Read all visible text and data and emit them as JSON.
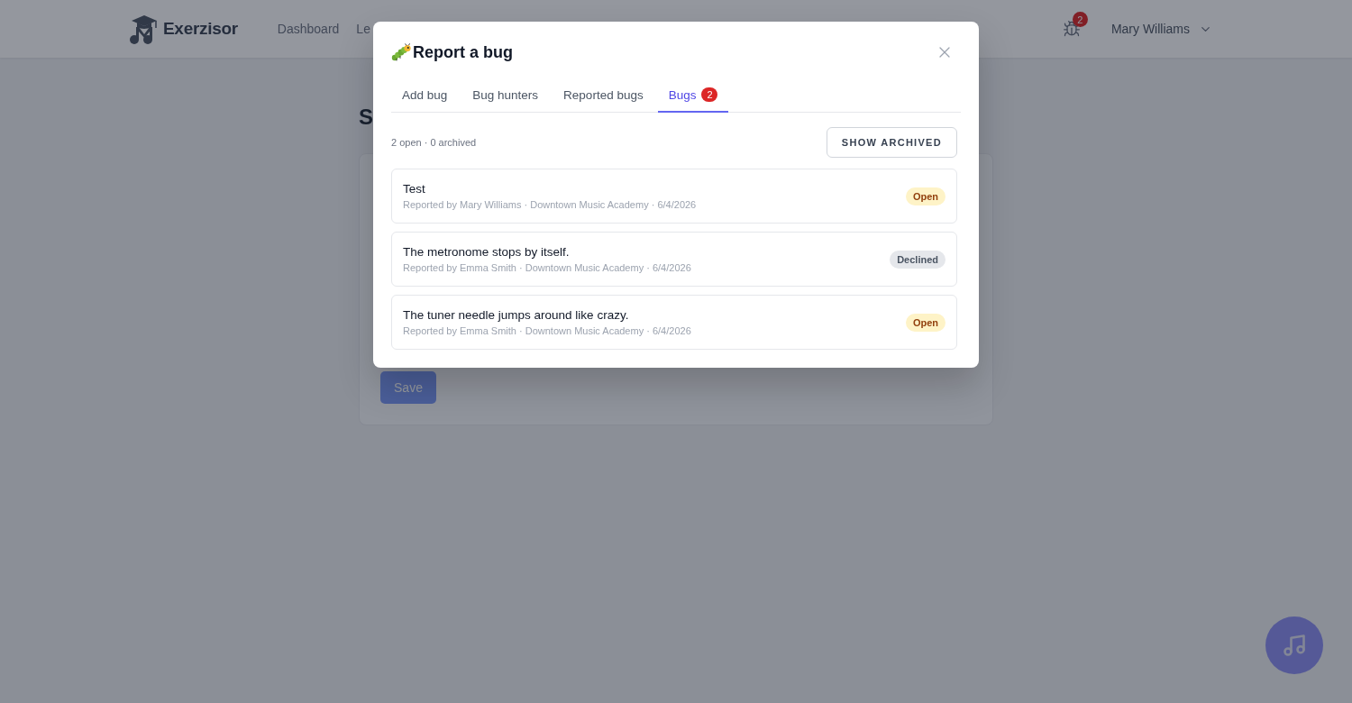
{
  "navbar": {
    "brand": "Exerzisor",
    "links": [
      "Dashboard",
      "Le"
    ],
    "bug_count": "2",
    "user": "Mary Williams"
  },
  "page": {
    "heading": "S",
    "save_button": "Save"
  },
  "dialog": {
    "title": "Report a bug",
    "tabs": [
      {
        "label": "Add bug",
        "selected": false
      },
      {
        "label": "Bug hunters",
        "selected": false
      },
      {
        "label": "Reported bugs",
        "selected": false
      },
      {
        "label": "Bugs",
        "selected": true,
        "badge": "2"
      }
    ],
    "summary": "2 open · 0 archived",
    "show_archived_button": "SHOW ARCHIVED",
    "bugs": [
      {
        "title": "Test",
        "meta": "Reported by Mary Williams · Downtown Music Academy · 6/4/2026",
        "status": "Open",
        "kind": "open"
      },
      {
        "title": "The metronome stops by itself.",
        "meta": "Reported by Emma Smith · Downtown Music Academy · 6/4/2026",
        "status": "Declined",
        "kind": "declined"
      },
      {
        "title": "The tuner needle jumps around like crazy.",
        "meta": "Reported by Emma Smith · Downtown Music Academy · 6/4/2026",
        "status": "Open",
        "kind": "open"
      }
    ]
  }
}
